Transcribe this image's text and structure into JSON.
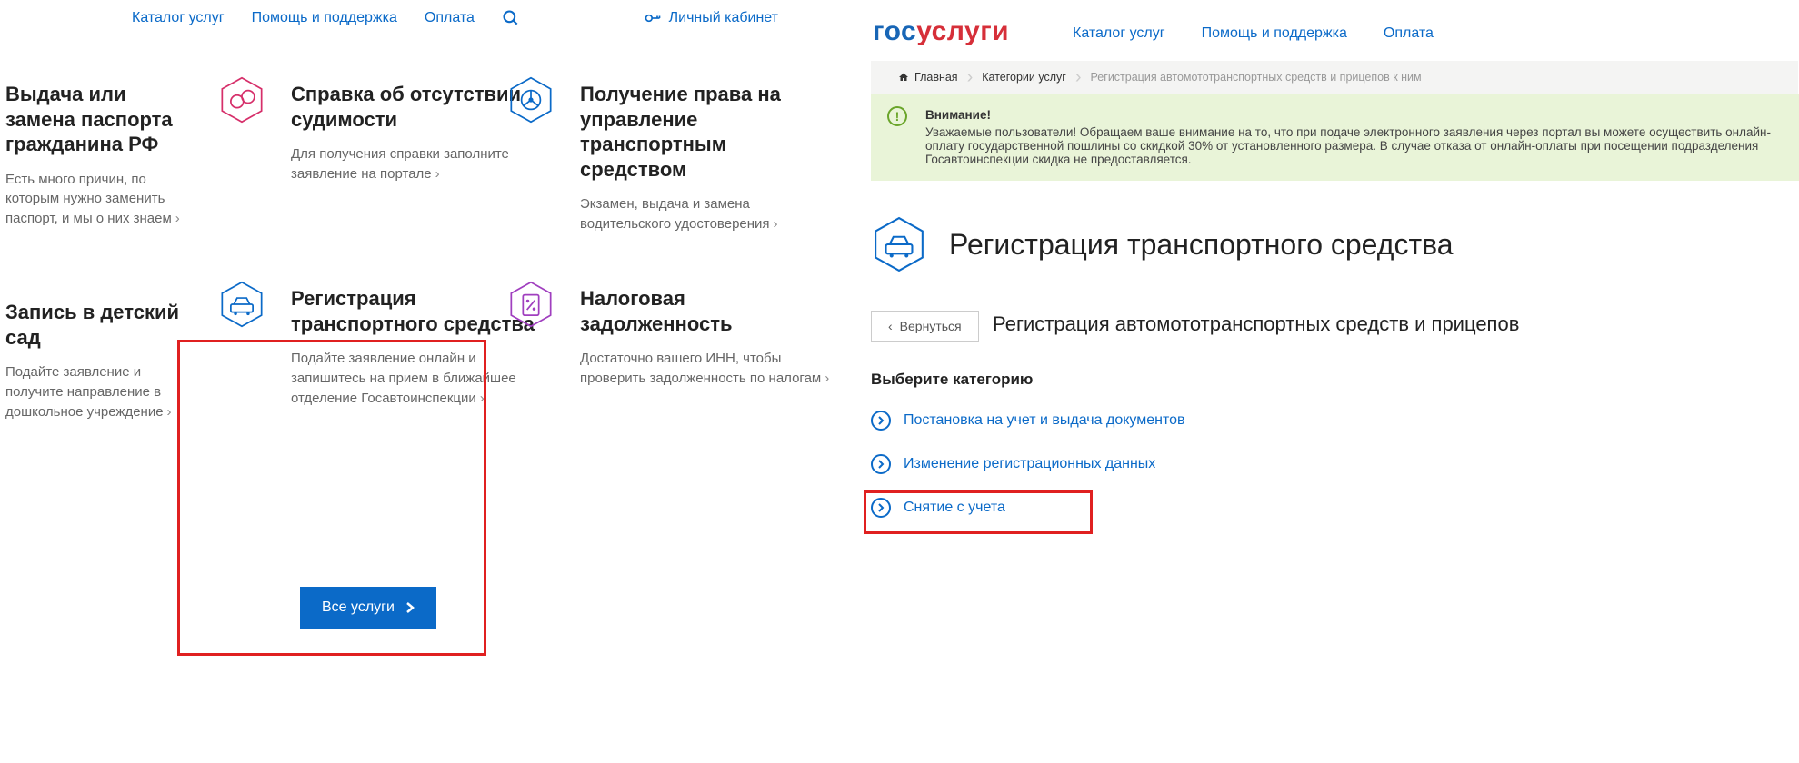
{
  "left_nav": {
    "catalog": "Каталог услуг",
    "support": "Помощь и поддержка",
    "pay": "Оплата",
    "account": "Личный кабинет"
  },
  "cards": {
    "passport": {
      "title": "Выдача или замена паспорта гражданина РФ",
      "desc": "Есть много причин, по которым нужно заменить паспорт, и мы о них знаем"
    },
    "crime": {
      "title": "Справка об отсутствии судимости",
      "desc": "Для получения справки заполните заявление на портале"
    },
    "drive": {
      "title": "Получение права на управление транспортным средством",
      "desc": "Экзамен, выдача и замена водительского удостоверения"
    },
    "kinder": {
      "title": "Запись в детский сад",
      "desc": "Подайте заявление и получите направление в дошкольное учреждение"
    },
    "reg": {
      "title": "Регистрация транспортного средства",
      "desc": "Подайте заявление онлайн и запишитесь на прием в ближайшее отделение Госавтоинспекции"
    },
    "tax": {
      "title": "Налоговая задолженность",
      "desc": "Достаточно вашего ИНН, чтобы проверить задолженность по налогам"
    }
  },
  "all_services_btn": "Все услуги",
  "right_nav": {
    "catalog": "Каталог услуг",
    "support": "Помощь и поддержка",
    "pay": "Оплата"
  },
  "logo": {
    "part1": "гос",
    "part2": "услуги"
  },
  "breadcrumb": {
    "home": "Главная",
    "categories": "Категории услуг",
    "current": "Регистрация автомототранспортных средств и прицепов к ним"
  },
  "notice": {
    "title": "Внимание!",
    "body": "Уважаемые пользователи! Обращаем ваше внимание на то, что при подаче электронного заявления через портал вы можете осуществить онлайн-оплату государственной пошлины со скидкой 30% от установленного размера. В случае отказа от онлайн-оплаты при посещении подразделения Госавтоинспекции скидка не предоставляется."
  },
  "page_title": "Регистрация транспортного средства",
  "back": "Вернуться",
  "sub_heading": "Регистрация автомототранспортных средств и прицепов",
  "choose_label": "Выберите категорию",
  "categories": [
    "Постановка на учет и выдача документов",
    "Изменение регистрационных данных",
    "Снятие с учета"
  ]
}
